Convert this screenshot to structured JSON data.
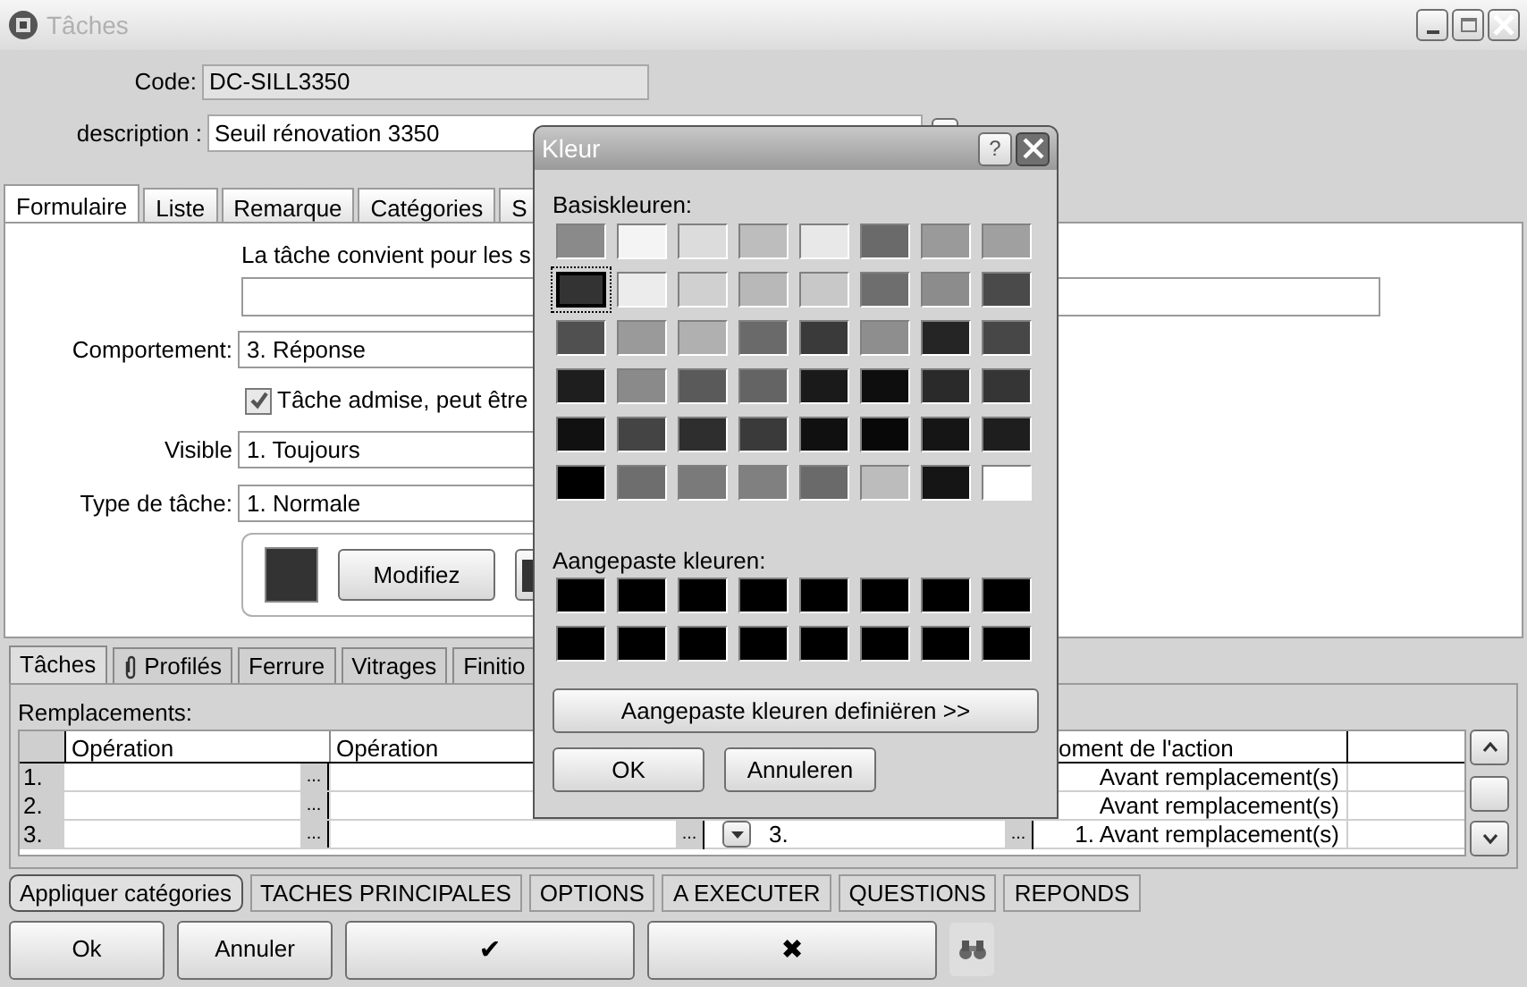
{
  "window": {
    "title": "Tâches"
  },
  "form": {
    "code": {
      "label": "Code:",
      "value": "DC-SILL3350"
    },
    "description": {
      "label": "description :",
      "value": "Seuil rénovation 3350"
    }
  },
  "tabs": [
    {
      "label": "Formulaire",
      "selected": true
    },
    {
      "label": "Liste",
      "selected": false
    },
    {
      "label": "Remarque",
      "selected": false
    },
    {
      "label": "Catégories",
      "selected": false
    },
    {
      "label": "S",
      "selected": false
    }
  ],
  "panel": {
    "suitability_text": "La tâche convient pour les s",
    "comportement": {
      "label": "Comportement:",
      "value": "3.  Réponse"
    },
    "admitted": {
      "label": "Tâche admise, peut être",
      "checked": true
    },
    "visible": {
      "label": "Visible",
      "value": "1.  Toujours"
    },
    "task_type": {
      "label": "Type de tâche:",
      "value": "1.  Normale"
    },
    "color_box": {
      "color": "#333333",
      "button": "Modifiez"
    }
  },
  "lower_tabs": [
    {
      "label": "Tâches",
      "kind": "plain",
      "selected": true
    },
    {
      "label": "Profilés",
      "kind": "attachment",
      "selected": false
    },
    {
      "label": "Ferrure",
      "kind": "plain",
      "selected": false
    },
    {
      "label": "Vitrages",
      "kind": "plain",
      "selected": false
    },
    {
      "label": "Finitio",
      "kind": "plain",
      "selected": false
    }
  ],
  "grid": {
    "title": "Remplacements:",
    "columns": {
      "operation_1": "Opération",
      "operation_2": "Opération",
      "moment": "oment de l'action"
    },
    "rows": [
      {
        "number": "1.",
        "operation_1_button": "...",
        "moment": "Avant remplacement(s)",
        "dropdown": false
      },
      {
        "number": "2.",
        "operation_1_button": "...",
        "moment": "Avant remplacement(s)",
        "dropdown": false
      },
      {
        "number": "3.",
        "operation_1_button": "...",
        "operation_2_button": "...",
        "column_3": "3.",
        "column_3_button": "...",
        "moment": "1. Avant remplacement(s)",
        "dropdown": true
      }
    ]
  },
  "categories": [
    {
      "label": "Appliquer catégories",
      "selected": true
    },
    {
      "label": "TACHES PRINCIPALES",
      "selected": false
    },
    {
      "label": "OPTIONS",
      "selected": false
    },
    {
      "label": "A EXECUTER",
      "selected": false
    },
    {
      "label": "QUESTIONS",
      "selected": false
    },
    {
      "label": "REPONDS",
      "selected": false
    }
  ],
  "buttons": [
    {
      "kind": "text",
      "label": "Ok"
    },
    {
      "kind": "text",
      "label": "Annuler"
    },
    {
      "kind": "symbol",
      "label": "✔"
    },
    {
      "kind": "symbol",
      "label": "✖"
    },
    {
      "kind": "search"
    }
  ],
  "color_dialog": {
    "title": "Kleur",
    "help": "?",
    "basic_label": "Basiskleuren:",
    "basic_colors": [
      {
        "color": "#8a8a8a",
        "selected": false
      },
      {
        "color": "#f4f4f4",
        "selected": false
      },
      {
        "color": "#dcdcdc",
        "selected": false
      },
      {
        "color": "#bdbdbd",
        "selected": false
      },
      {
        "color": "#e8e8e8",
        "selected": false
      },
      {
        "color": "#6a6a6a",
        "selected": false
      },
      {
        "color": "#9a9a9a",
        "selected": false
      },
      {
        "color": "#a0a0a0",
        "selected": false
      },
      {
        "color": "#333333",
        "selected": true
      },
      {
        "color": "#ececec",
        "selected": false
      },
      {
        "color": "#d0d0d0",
        "selected": false
      },
      {
        "color": "#b8b8b8",
        "selected": false
      },
      {
        "color": "#c8c8c8",
        "selected": false
      },
      {
        "color": "#6e6e6e",
        "selected": false
      },
      {
        "color": "#8c8c8c",
        "selected": false
      },
      {
        "color": "#4a4a4a",
        "selected": false
      },
      {
        "color": "#505050",
        "selected": false
      },
      {
        "color": "#9a9a9a",
        "selected": false
      },
      {
        "color": "#b0b0b0",
        "selected": false
      },
      {
        "color": "#6a6a6a",
        "selected": false
      },
      {
        "color": "#3a3a3a",
        "selected": false
      },
      {
        "color": "#8e8e8e",
        "selected": false
      },
      {
        "color": "#252525",
        "selected": false
      },
      {
        "color": "#474747",
        "selected": false
      },
      {
        "color": "#1e1e1e",
        "selected": false
      },
      {
        "color": "#8a8a8a",
        "selected": false
      },
      {
        "color": "#5a5a5a",
        "selected": false
      },
      {
        "color": "#646464",
        "selected": false
      },
      {
        "color": "#1a1a1a",
        "selected": false
      },
      {
        "color": "#0e0e0e",
        "selected": false
      },
      {
        "color": "#2a2a2a",
        "selected": false
      },
      {
        "color": "#353535",
        "selected": false
      },
      {
        "color": "#111111",
        "selected": false
      },
      {
        "color": "#444444",
        "selected": false
      },
      {
        "color": "#2e2e2e",
        "selected": false
      },
      {
        "color": "#3a3a3a",
        "selected": false
      },
      {
        "color": "#101010",
        "selected": false
      },
      {
        "color": "#080808",
        "selected": false
      },
      {
        "color": "#151515",
        "selected": false
      },
      {
        "color": "#1e1e1e",
        "selected": false
      },
      {
        "color": "#000000",
        "selected": false
      },
      {
        "color": "#6e6e6e",
        "selected": false
      },
      {
        "color": "#7a7a7a",
        "selected": false
      },
      {
        "color": "#808080",
        "selected": false
      },
      {
        "color": "#6a6a6a",
        "selected": false
      },
      {
        "color": "#bcbcbc",
        "selected": false
      },
      {
        "color": "#151515",
        "selected": false
      },
      {
        "color": "#ffffff",
        "selected": false
      }
    ],
    "custom_label": "Aangepaste kleuren:",
    "custom_colors": [
      {
        "color": "#000000",
        "selected": false
      },
      {
        "color": "#000000",
        "selected": false
      },
      {
        "color": "#000000",
        "selected": false
      },
      {
        "color": "#000000",
        "selected": false
      },
      {
        "color": "#000000",
        "selected": false
      },
      {
        "color": "#000000",
        "selected": false
      },
      {
        "color": "#000000",
        "selected": false
      },
      {
        "color": "#000000",
        "selected": false
      },
      {
        "color": "#000000",
        "selected": false
      },
      {
        "color": "#000000",
        "selected": false
      },
      {
        "color": "#000000",
        "selected": false
      },
      {
        "color": "#000000",
        "selected": false
      },
      {
        "color": "#000000",
        "selected": false
      },
      {
        "color": "#000000",
        "selected": false
      },
      {
        "color": "#000000",
        "selected": false
      },
      {
        "color": "#000000",
        "selected": false
      }
    ],
    "define_button": "Aangepaste kleuren definiëren >>",
    "ok": "OK",
    "cancel": "Annuleren"
  }
}
